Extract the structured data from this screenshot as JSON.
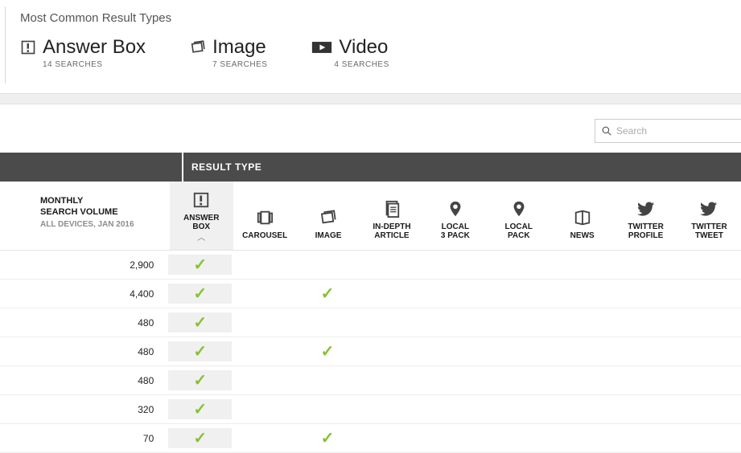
{
  "summary": {
    "title": "Most Common Result Types",
    "items": [
      {
        "icon": "answer-box",
        "label": "Answer Box",
        "sub": "14 SEARCHES"
      },
      {
        "icon": "image",
        "label": "Image",
        "sub": "7 SEARCHES"
      },
      {
        "icon": "video",
        "label": "Video",
        "sub": "4 SEARCHES"
      }
    ]
  },
  "search": {
    "placeholder": "Search"
  },
  "table": {
    "result_type_header": "RESULT TYPE",
    "volume_header": {
      "line1": "MONTHLY",
      "line2": "SEARCH VOLUME",
      "meta": "ALL DEVICES, JAN 2016"
    },
    "columns": [
      {
        "key": "answer_box",
        "label": "ANSWER BOX",
        "icon": "answer-box",
        "sorted": true
      },
      {
        "key": "carousel",
        "label": "CAROUSEL",
        "icon": "carousel"
      },
      {
        "key": "image",
        "label": "IMAGE",
        "icon": "image"
      },
      {
        "key": "in_depth_article",
        "label": "IN-DEPTH ARTICLE",
        "icon": "doc"
      },
      {
        "key": "local_3_pack",
        "label": "LOCAL 3 PACK",
        "icon": "pin"
      },
      {
        "key": "local_pack",
        "label": "LOCAL PACK",
        "icon": "pin"
      },
      {
        "key": "news",
        "label": "NEWS",
        "icon": "news"
      },
      {
        "key": "twitter_profile",
        "label": "TWITTER PROFILE",
        "icon": "twitter"
      },
      {
        "key": "twitter_tweet",
        "label": "TWITTER TWEET",
        "icon": "twitter"
      }
    ],
    "rows": [
      {
        "volume": "2,900",
        "checks": {
          "answer_box": true
        }
      },
      {
        "volume": "4,400",
        "checks": {
          "answer_box": true,
          "image": true
        }
      },
      {
        "volume": "480",
        "checks": {
          "answer_box": true
        }
      },
      {
        "volume": "480",
        "checks": {
          "answer_box": true,
          "image": true
        }
      },
      {
        "volume": "480",
        "checks": {
          "answer_box": true
        }
      },
      {
        "volume": "320",
        "checks": {
          "answer_box": true
        }
      },
      {
        "volume": "70",
        "checks": {
          "answer_box": true,
          "image": true
        }
      }
    ]
  }
}
